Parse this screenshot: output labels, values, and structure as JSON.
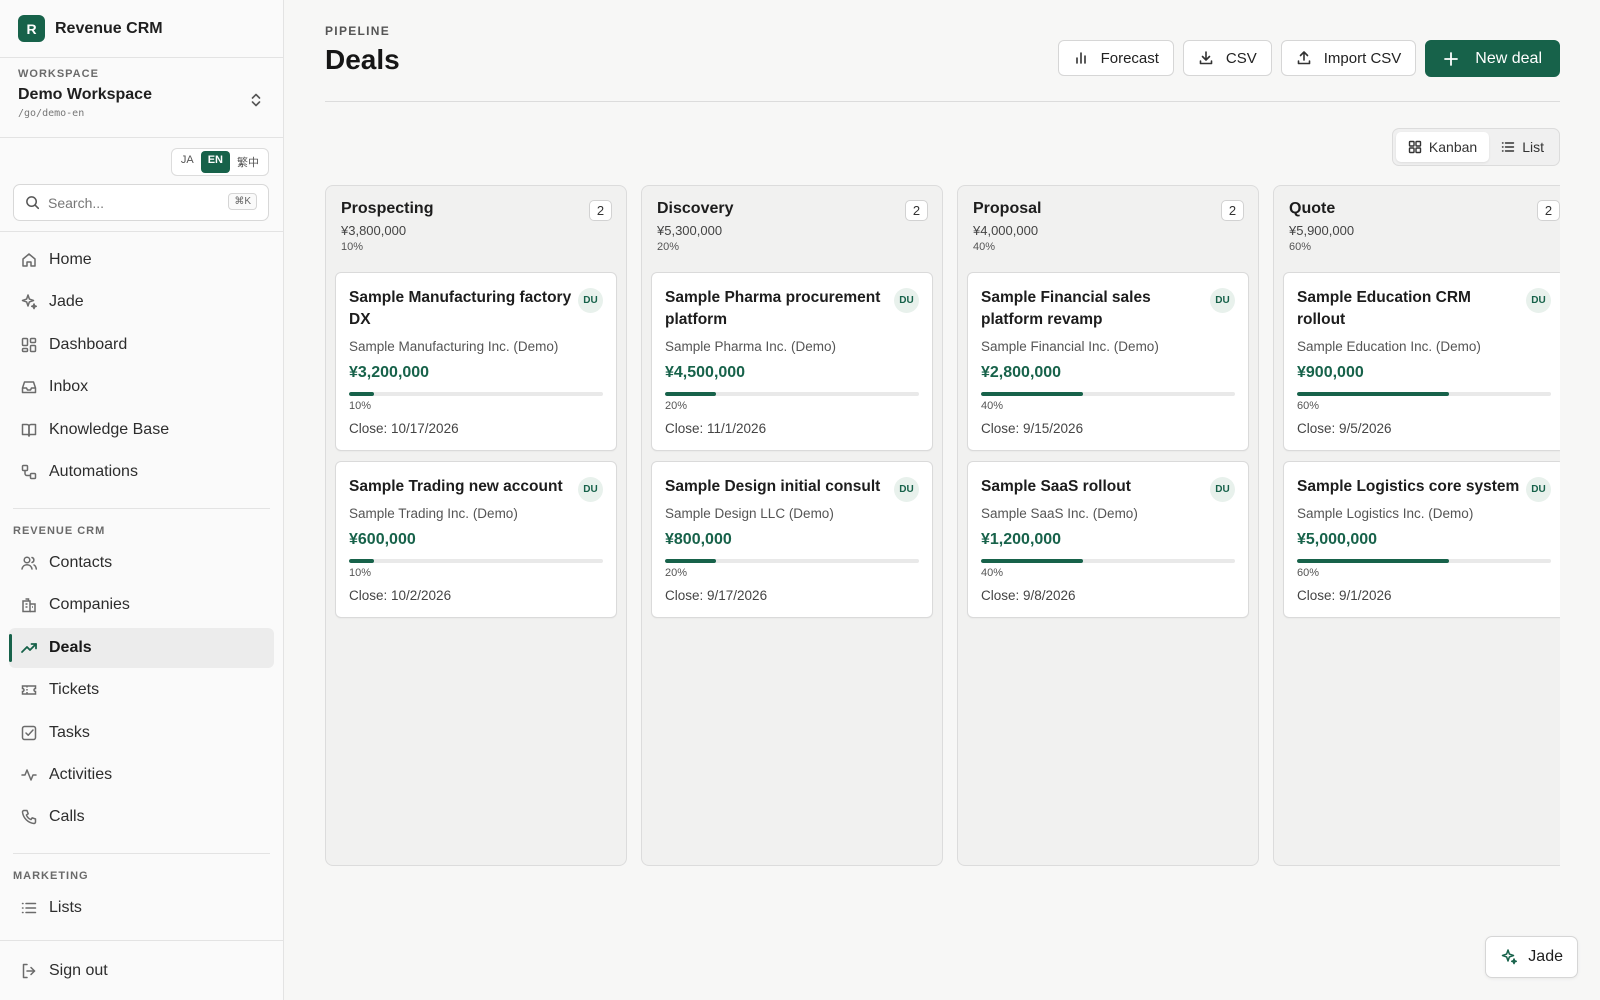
{
  "brand": {
    "logo_letter": "R",
    "name": "Revenue CRM",
    "color": "#17624a"
  },
  "workspace": {
    "label": "WORKSPACE",
    "name": "Demo Workspace",
    "path": "/go/demo-en"
  },
  "languages": [
    {
      "code": "JA",
      "active": false
    },
    {
      "code": "EN",
      "active": true
    },
    {
      "code": "繁中",
      "active": false
    }
  ],
  "search": {
    "placeholder": "Search...",
    "shortcut": "⌘K"
  },
  "nav_primary": [
    {
      "label": "Home",
      "icon": "home-icon"
    },
    {
      "label": "Jade",
      "icon": "sparkles-icon"
    },
    {
      "label": "Dashboard",
      "icon": "dashboard-icon"
    },
    {
      "label": "Inbox",
      "icon": "inbox-icon"
    },
    {
      "label": "Knowledge Base",
      "icon": "book-icon"
    },
    {
      "label": "Automations",
      "icon": "workflow-icon"
    }
  ],
  "section_crm": "REVENUE CRM",
  "nav_crm": [
    {
      "label": "Contacts",
      "icon": "users-icon"
    },
    {
      "label": "Companies",
      "icon": "building-icon"
    },
    {
      "label": "Deals",
      "icon": "trending-up-icon",
      "active": true
    },
    {
      "label": "Tickets",
      "icon": "ticket-icon"
    },
    {
      "label": "Tasks",
      "icon": "checkbox-icon"
    },
    {
      "label": "Activities",
      "icon": "activity-icon"
    },
    {
      "label": "Calls",
      "icon": "phone-icon"
    }
  ],
  "section_marketing": "MARKETING",
  "nav_marketing": [
    {
      "label": "Lists",
      "icon": "list-icon"
    }
  ],
  "signout": "Sign out",
  "header": {
    "eyebrow": "PIPELINE",
    "title": "Deals"
  },
  "actions": {
    "forecast": "Forecast",
    "csv": "CSV",
    "import_csv": "Import CSV",
    "new_deal": "New deal"
  },
  "view_toggle": {
    "kanban": "Kanban",
    "list": "List",
    "active": "kanban"
  },
  "columns": [
    {
      "name": "Prospecting",
      "count": "2",
      "amount": "¥3,800,000",
      "pct": "10%",
      "cards": [
        {
          "title": "Sample Manufacturing factory DX",
          "owner": "DU",
          "company": "Sample Manufacturing Inc. (Demo)",
          "amount": "¥3,200,000",
          "probability": 10,
          "pct": "10%",
          "close": "Close: 10/17/2026"
        },
        {
          "title": "Sample Trading new account",
          "owner": "DU",
          "company": "Sample Trading Inc. (Demo)",
          "amount": "¥600,000",
          "probability": 10,
          "pct": "10%",
          "close": "Close: 10/2/2026"
        }
      ]
    },
    {
      "name": "Discovery",
      "count": "2",
      "amount": "¥5,300,000",
      "pct": "20%",
      "cards": [
        {
          "title": "Sample Pharma procurement platform",
          "owner": "DU",
          "company": "Sample Pharma Inc. (Demo)",
          "amount": "¥4,500,000",
          "probability": 20,
          "pct": "20%",
          "close": "Close: 11/1/2026"
        },
        {
          "title": "Sample Design initial consult",
          "owner": "DU",
          "company": "Sample Design LLC (Demo)",
          "amount": "¥800,000",
          "probability": 20,
          "pct": "20%",
          "close": "Close: 9/17/2026"
        }
      ]
    },
    {
      "name": "Proposal",
      "count": "2",
      "amount": "¥4,000,000",
      "pct": "40%",
      "cards": [
        {
          "title": "Sample Financial sales platform revamp",
          "owner": "DU",
          "company": "Sample Financial Inc. (Demo)",
          "amount": "¥2,800,000",
          "probability": 40,
          "pct": "40%",
          "close": "Close: 9/15/2026"
        },
        {
          "title": "Sample SaaS rollout",
          "owner": "DU",
          "company": "Sample SaaS Inc. (Demo)",
          "amount": "¥1,200,000",
          "probability": 40,
          "pct": "40%",
          "close": "Close: 9/8/2026"
        }
      ]
    },
    {
      "name": "Quote",
      "count": "2",
      "amount": "¥5,900,000",
      "pct": "60%",
      "cards": [
        {
          "title": "Sample Education CRM rollout",
          "owner": "DU",
          "company": "Sample Education Inc. (Demo)",
          "amount": "¥900,000",
          "probability": 60,
          "pct": "60%",
          "close": "Close: 9/5/2026"
        },
        {
          "title": "Sample Logistics core system",
          "owner": "DU",
          "company": "Sample Logistics Inc. (Demo)",
          "amount": "¥5,000,000",
          "probability": 60,
          "pct": "60%",
          "close": "Close: 9/1/2026"
        }
      ]
    }
  ],
  "assistant_button": "Jade"
}
